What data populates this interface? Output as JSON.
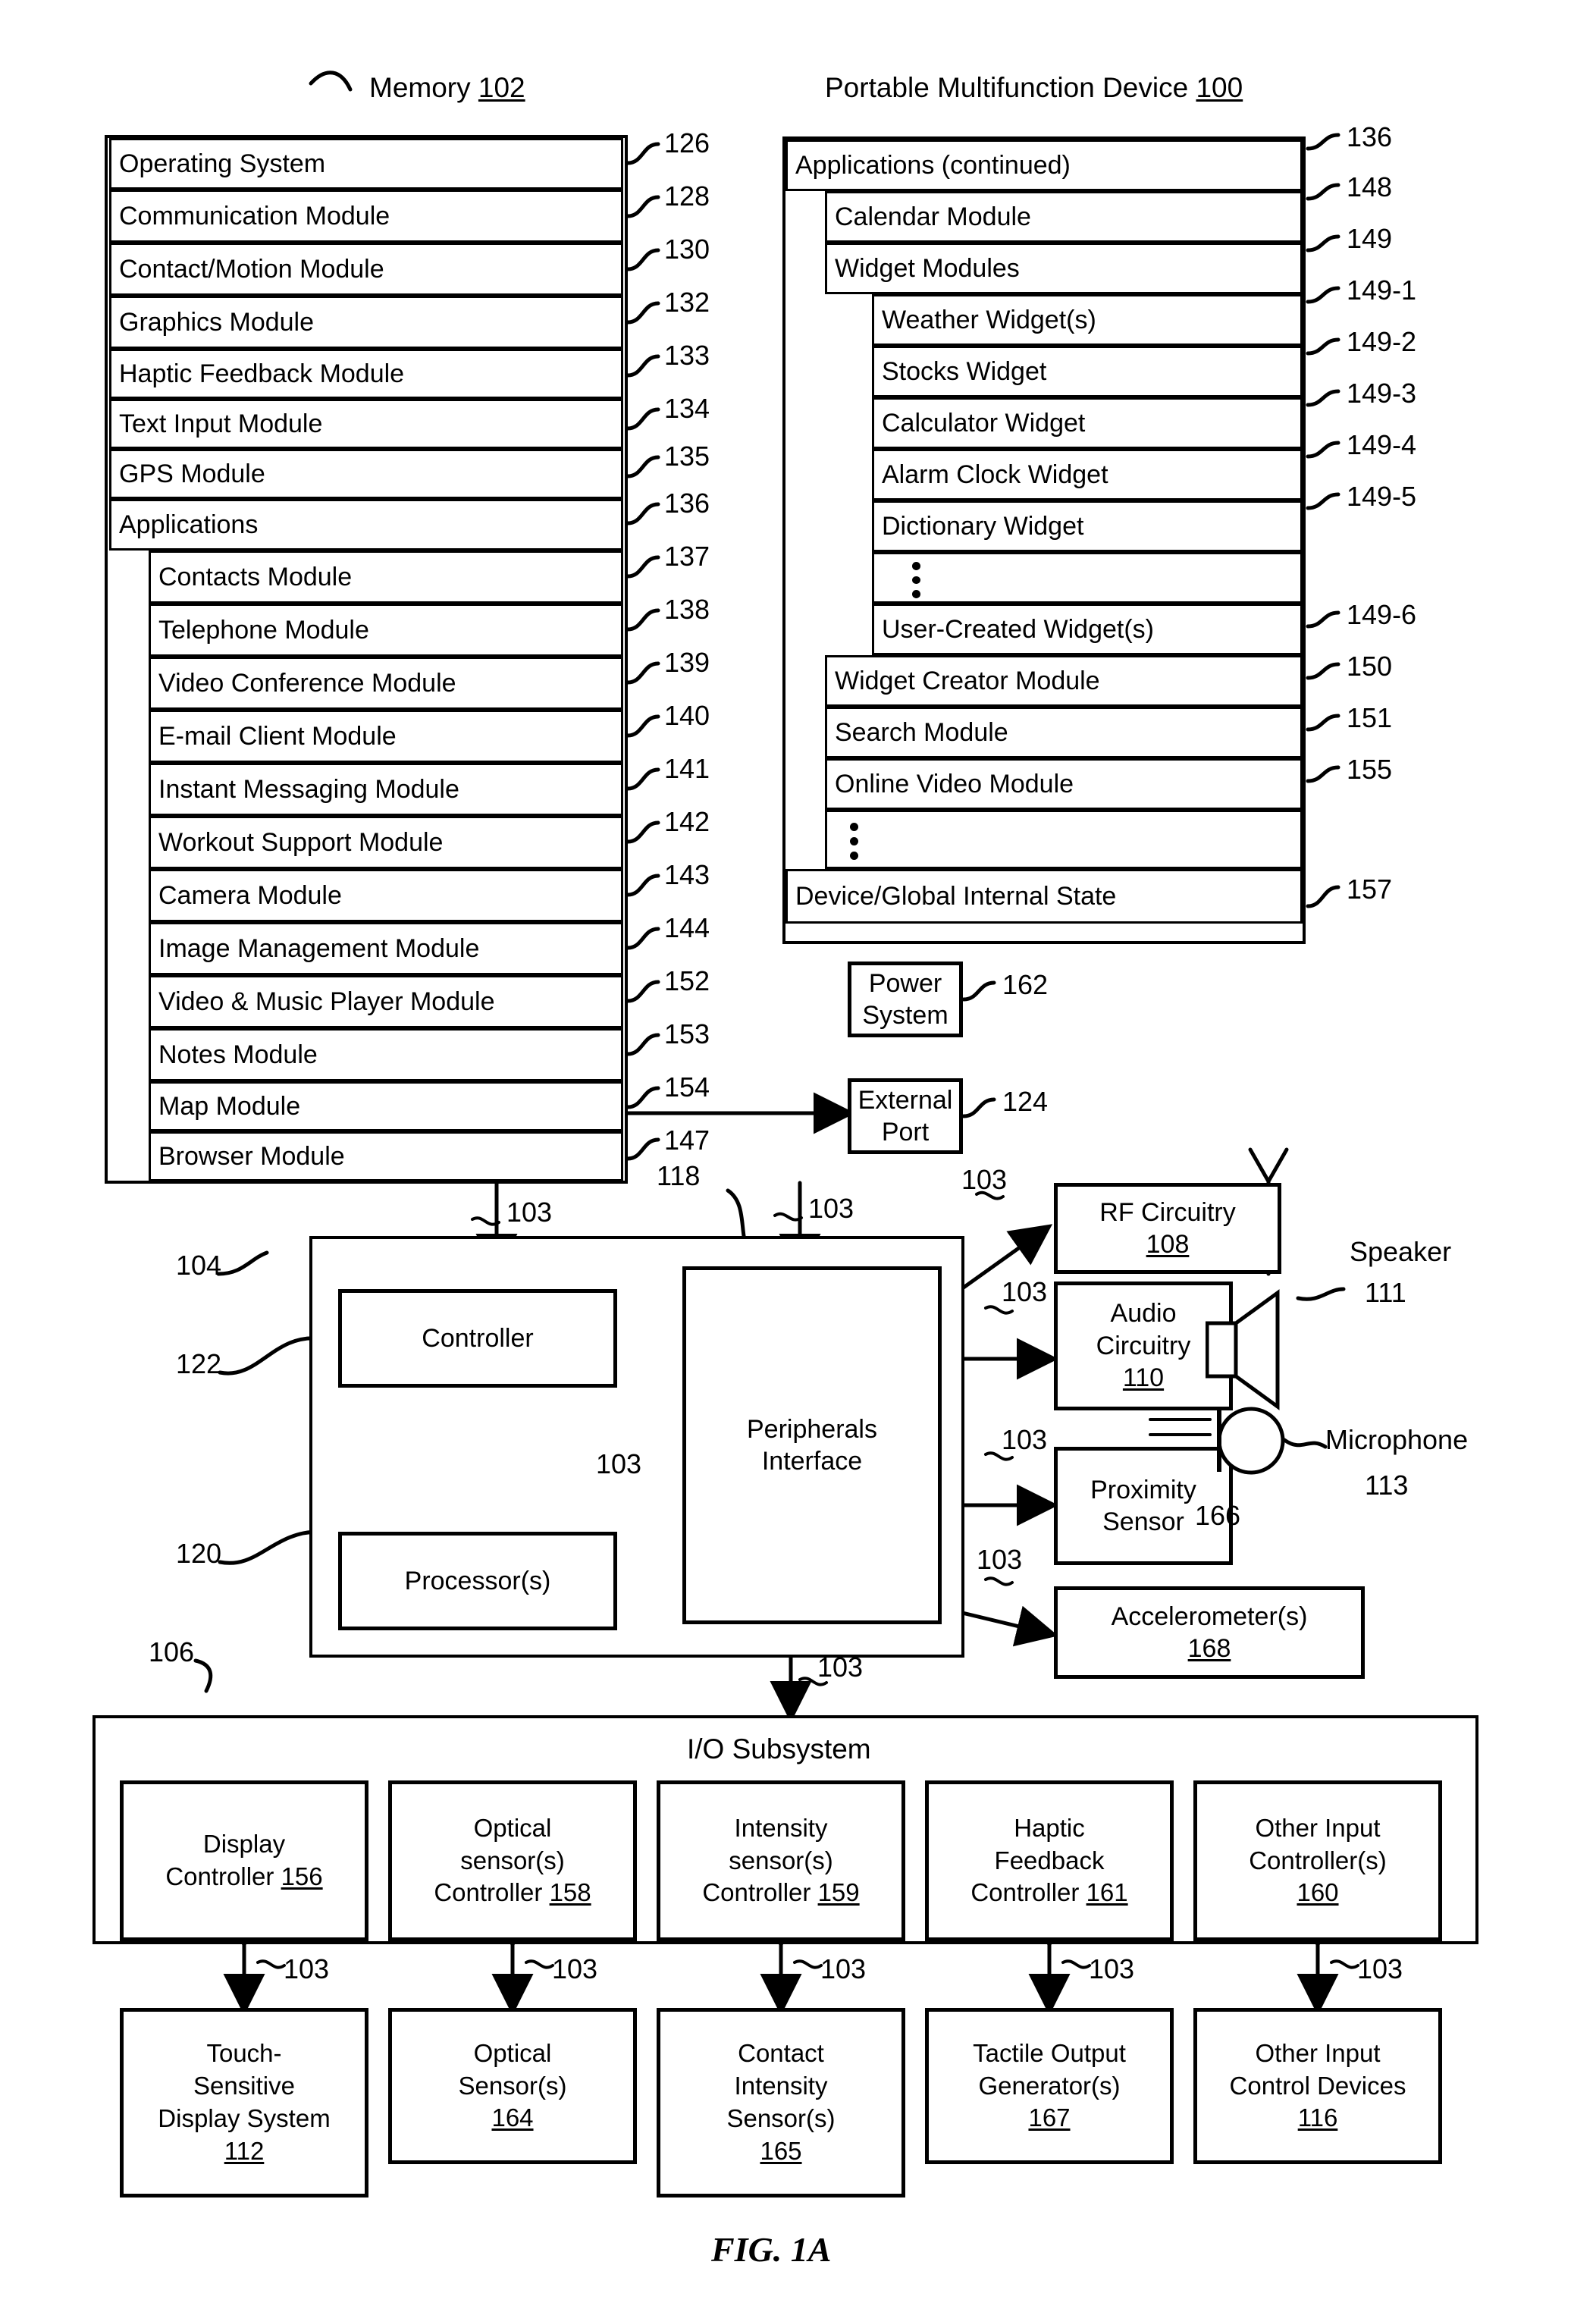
{
  "figure": {
    "caption": "FIG. 1A",
    "memory_title": "Memory",
    "memory_ref": "102",
    "device_title": "Portable Multifunction Device",
    "device_ref": "100"
  },
  "memory_panel": {
    "items": [
      {
        "label": "Operating System",
        "ref": "126",
        "indent": 0
      },
      {
        "label": "Communication Module",
        "ref": "128",
        "indent": 0
      },
      {
        "label": "Contact/Motion Module",
        "ref": "130",
        "indent": 0
      },
      {
        "label": "Graphics Module",
        "ref": "132",
        "indent": 0
      },
      {
        "label": "Haptic Feedback Module",
        "ref": "133",
        "indent": 0
      },
      {
        "label": "Text Input Module",
        "ref": "134",
        "indent": 0
      },
      {
        "label": "GPS Module",
        "ref": "135",
        "indent": 0
      },
      {
        "label": "Applications",
        "ref": "136",
        "indent": 0
      },
      {
        "label": "Contacts Module",
        "ref": "137",
        "indent": 1
      },
      {
        "label": "Telephone Module",
        "ref": "138",
        "indent": 1
      },
      {
        "label": "Video Conference Module",
        "ref": "139",
        "indent": 1
      },
      {
        "label": "E-mail Client Module",
        "ref": "140",
        "indent": 1
      },
      {
        "label": "Instant Messaging Module",
        "ref": "141",
        "indent": 1
      },
      {
        "label": "Workout Support Module",
        "ref": "142",
        "indent": 1
      },
      {
        "label": "Camera Module",
        "ref": "143",
        "indent": 1
      },
      {
        "label": "Image Management Module",
        "ref": "144",
        "indent": 1
      },
      {
        "label": "Video & Music Player Module",
        "ref": "152",
        "indent": 1
      },
      {
        "label": "Notes Module",
        "ref": "153",
        "indent": 1
      },
      {
        "label": "Map Module",
        "ref": "154",
        "indent": 1
      },
      {
        "label": "Browser Module",
        "ref": "147",
        "indent": 1
      }
    ]
  },
  "applications_panel": {
    "header": {
      "label": "Applications (continued)",
      "ref": "136"
    },
    "items": [
      {
        "label": "Calendar Module",
        "ref": "148",
        "indent": 1
      },
      {
        "label": "Widget Modules",
        "ref": "149",
        "indent": 1
      },
      {
        "label": "Weather Widget(s)",
        "ref": "149-1",
        "indent": 2
      },
      {
        "label": "Stocks Widget",
        "ref": "149-2",
        "indent": 2
      },
      {
        "label": "Calculator Widget",
        "ref": "149-3",
        "indent": 2
      },
      {
        "label": "Alarm Clock Widget",
        "ref": "149-4",
        "indent": 2
      },
      {
        "label": "Dictionary Widget",
        "ref": "149-5",
        "indent": 2
      },
      {
        "label": "",
        "ref": "",
        "indent": 2,
        "dots": true
      },
      {
        "label": "User-Created Widget(s)",
        "ref": "149-6",
        "indent": 2
      },
      {
        "label": "Widget Creator Module",
        "ref": "150",
        "indent": 1
      },
      {
        "label": "Search Module",
        "ref": "151",
        "indent": 1
      },
      {
        "label": "Online Video Module",
        "ref": "155",
        "indent": 1
      },
      {
        "label": "",
        "ref": "",
        "indent": 1,
        "dots": true
      }
    ],
    "footer": {
      "label": "Device/Global Internal State",
      "ref": "157"
    }
  },
  "core": {
    "controller": {
      "label": "Controller",
      "ref": "122"
    },
    "processor": {
      "label": "Processor(s)",
      "ref": "120"
    },
    "peripherals": {
      "line1": "Peripherals",
      "line2": "Interface",
      "ref": "118"
    },
    "core_block_ref": "104",
    "io_subsystem_ref": "106",
    "bus_label": "103"
  },
  "peripherals_blocks": {
    "power_system": {
      "line1": "Power",
      "line2": "System",
      "ref": "162"
    },
    "external_port": {
      "line1": "External",
      "line2": "Port",
      "ref": "124"
    },
    "rf_circuitry": {
      "line1": "RF Circuitry",
      "ref": "108"
    },
    "audio_circuitry": {
      "line1": "Audio",
      "line2": "Circuitry",
      "ref": "110"
    },
    "proximity_sensor": {
      "line1": "Proximity",
      "line2": "Sensor",
      "ref": "166"
    },
    "accelerometer": {
      "line1": "Accelerometer(s)",
      "ref": "168"
    },
    "speaker": {
      "label": "Speaker",
      "ref": "111"
    },
    "microphone": {
      "label": "Microphone",
      "ref": "113"
    }
  },
  "io_subsystem": {
    "title": "I/O Subsystem",
    "controllers": [
      {
        "lines": [
          "Display",
          "Controller"
        ],
        "ref": "156"
      },
      {
        "lines": [
          "Optical",
          "sensor(s)",
          "Controller"
        ],
        "ref": "158"
      },
      {
        "lines": [
          "Intensity",
          "sensor(s)",
          "Controller"
        ],
        "ref": "159"
      },
      {
        "lines": [
          "Haptic",
          "Feedback",
          "Controller"
        ],
        "ref": "161"
      },
      {
        "lines": [
          "Other Input",
          "Controller(s)"
        ],
        "ref": "160"
      }
    ],
    "devices": [
      {
        "lines": [
          "Touch-",
          "Sensitive",
          "Display System"
        ],
        "ref": "112"
      },
      {
        "lines": [
          "Optical",
          "Sensor(s)"
        ],
        "ref": "164"
      },
      {
        "lines": [
          "Contact",
          "Intensity",
          "Sensor(s)"
        ],
        "ref": "165"
      },
      {
        "lines": [
          "Tactile Output",
          "Generator(s)"
        ],
        "ref": "167"
      },
      {
        "lines": [
          "Other Input",
          "Control Devices"
        ],
        "ref": "116"
      }
    ],
    "link_label": "103"
  },
  "bus_labels": [
    "103",
    "103",
    "103",
    "103",
    "103",
    "103",
    "103",
    "103",
    "103",
    "103",
    "103",
    "103",
    "103",
    "103"
  ]
}
